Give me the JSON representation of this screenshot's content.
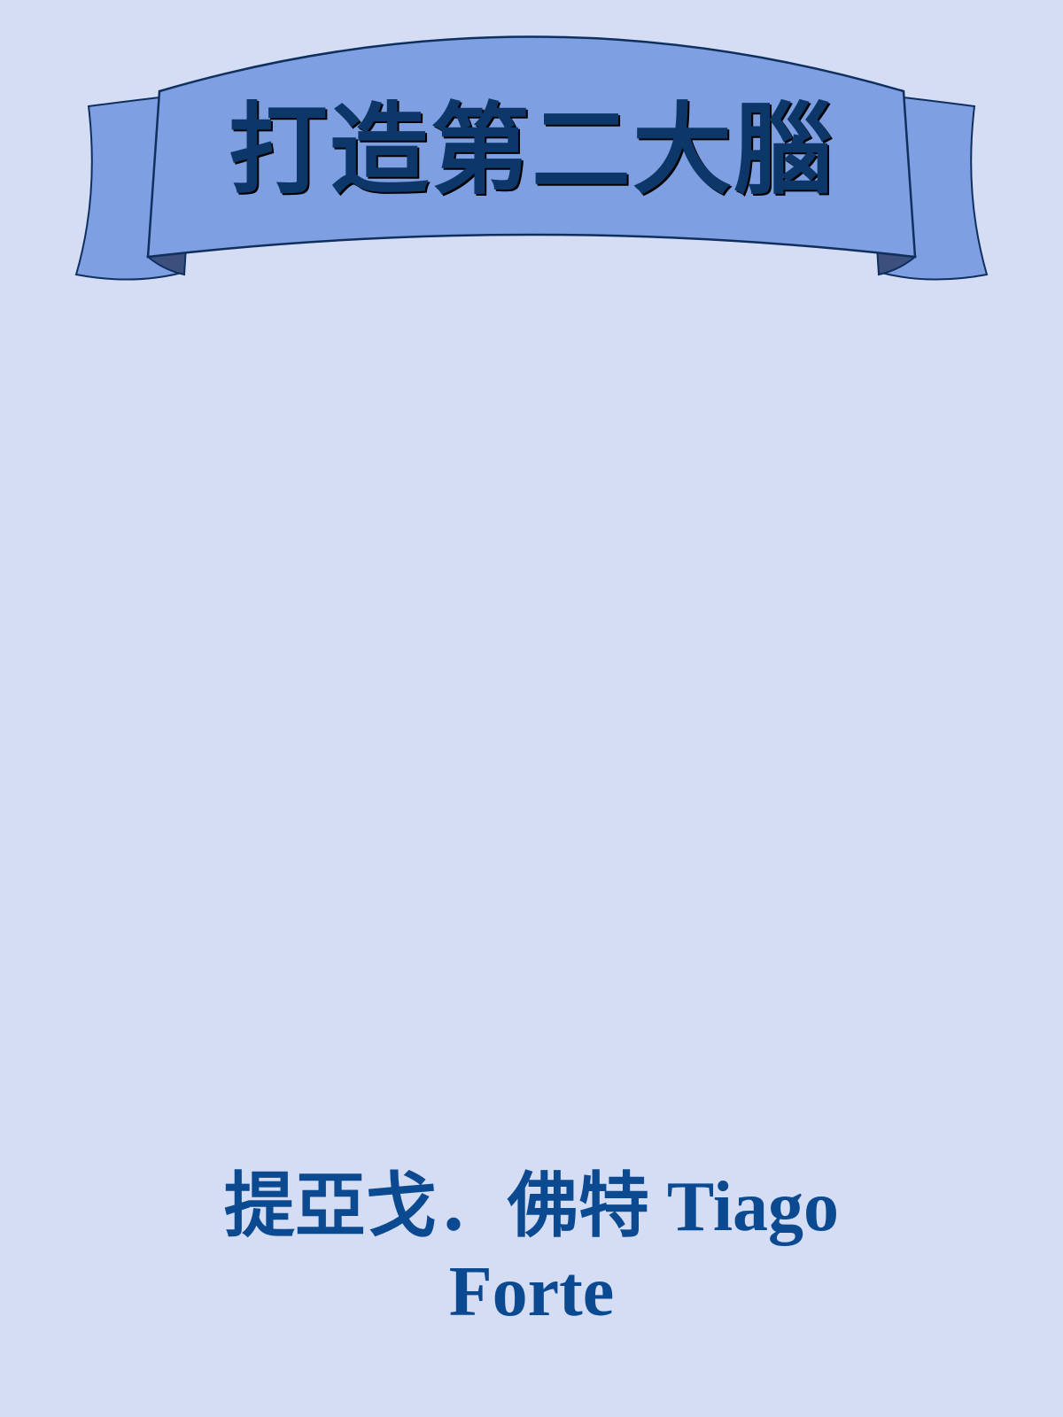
{
  "cover": {
    "title": "打造第二大腦",
    "author": "提亞戈．佛特 Tiago Forte"
  },
  "colors": {
    "background": "#d4ddf4",
    "ribbon_fill": "#7f9fe3",
    "ribbon_fold": "#3d4f7d",
    "ribbon_outline": "#0f2f5f",
    "title_text": "#0d3768",
    "author_text": "#0b4a91"
  }
}
